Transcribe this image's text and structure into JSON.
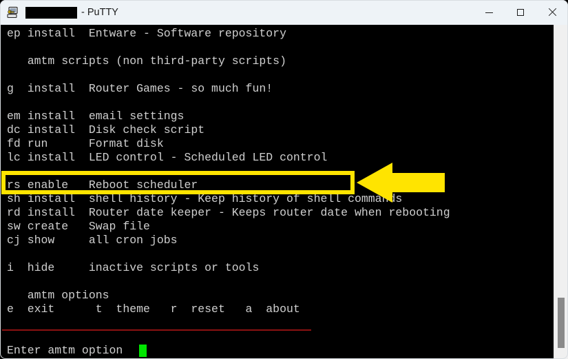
{
  "window": {
    "app_name": "PuTTY",
    "title_suffix": "- PuTTY",
    "icon": "putty-icon",
    "redacted_hostname": "",
    "controls": {
      "minimize": "minimize",
      "maximize": "maximize",
      "close": "close"
    }
  },
  "terminal": {
    "foreground": "#cfcfcf",
    "background": "#000000",
    "cursor_color": "#00e500",
    "separator_color": "#8c1212",
    "lines": [
      {
        "id": "ep",
        "text": "ep install  Entware - Software repository"
      },
      {
        "id": "b1",
        "text": ""
      },
      {
        "id": "hdr1",
        "text": "   amtm scripts (non third-party scripts)"
      },
      {
        "id": "b2",
        "text": ""
      },
      {
        "id": "g",
        "text": "g  install  Router Games - so much fun!"
      },
      {
        "id": "b3",
        "text": ""
      },
      {
        "id": "em",
        "text": "em install  email settings"
      },
      {
        "id": "dc",
        "text": "dc install  Disk check script"
      },
      {
        "id": "fd",
        "text": "fd run      Format disk"
      },
      {
        "id": "lc",
        "text": "lc install  LED control - Scheduled LED control"
      },
      {
        "id": "b4",
        "text": ""
      },
      {
        "id": "rs",
        "text": "rs enable   Reboot scheduler"
      },
      {
        "id": "sh",
        "text": "sh install  shell history - Keep history of shell commands"
      },
      {
        "id": "rd",
        "text": "rd install  Router date keeper - Keeps router date when rebooting"
      },
      {
        "id": "sw",
        "text": "sw create   Swap file"
      },
      {
        "id": "cj",
        "text": "cj show     all cron jobs"
      },
      {
        "id": "b5",
        "text": ""
      },
      {
        "id": "i",
        "text": "i  hide     inactive scripts or tools"
      },
      {
        "id": "b6",
        "text": ""
      },
      {
        "id": "hdr2",
        "text": "   amtm options"
      },
      {
        "id": "opts",
        "text": "e  exit      t  theme   r  reset   a  about"
      }
    ],
    "prompt": "Enter amtm option"
  },
  "annotations": {
    "highlight_color": "#ffe400",
    "highlighted_line_id": "lc",
    "highlighted_text": "lc install  LED control - Scheduled LED control",
    "arrow_direction": "left",
    "arrow_color": "#ffe400"
  },
  "scrollbar": {
    "thumb_color": "#8a8a8a",
    "track_color": "#f0f0f0"
  }
}
